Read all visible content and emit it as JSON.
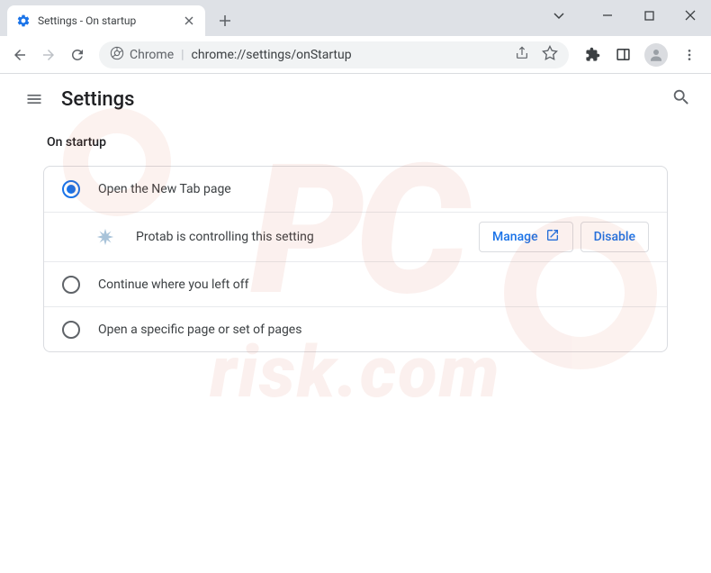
{
  "window": {
    "tab_title": "Settings - On startup"
  },
  "addressbar": {
    "chrome_label": "Chrome",
    "url": "chrome://settings/onStartup"
  },
  "settings": {
    "header_title": "Settings",
    "section_title": "On startup",
    "options": [
      {
        "label": "Open the New Tab page",
        "selected": true
      },
      {
        "label": "Continue where you left off",
        "selected": false
      },
      {
        "label": "Open a specific page or set of pages",
        "selected": false
      }
    ],
    "extension_notice": "Protab is controlling this setting",
    "manage_button": "Manage",
    "disable_button": "Disable"
  }
}
